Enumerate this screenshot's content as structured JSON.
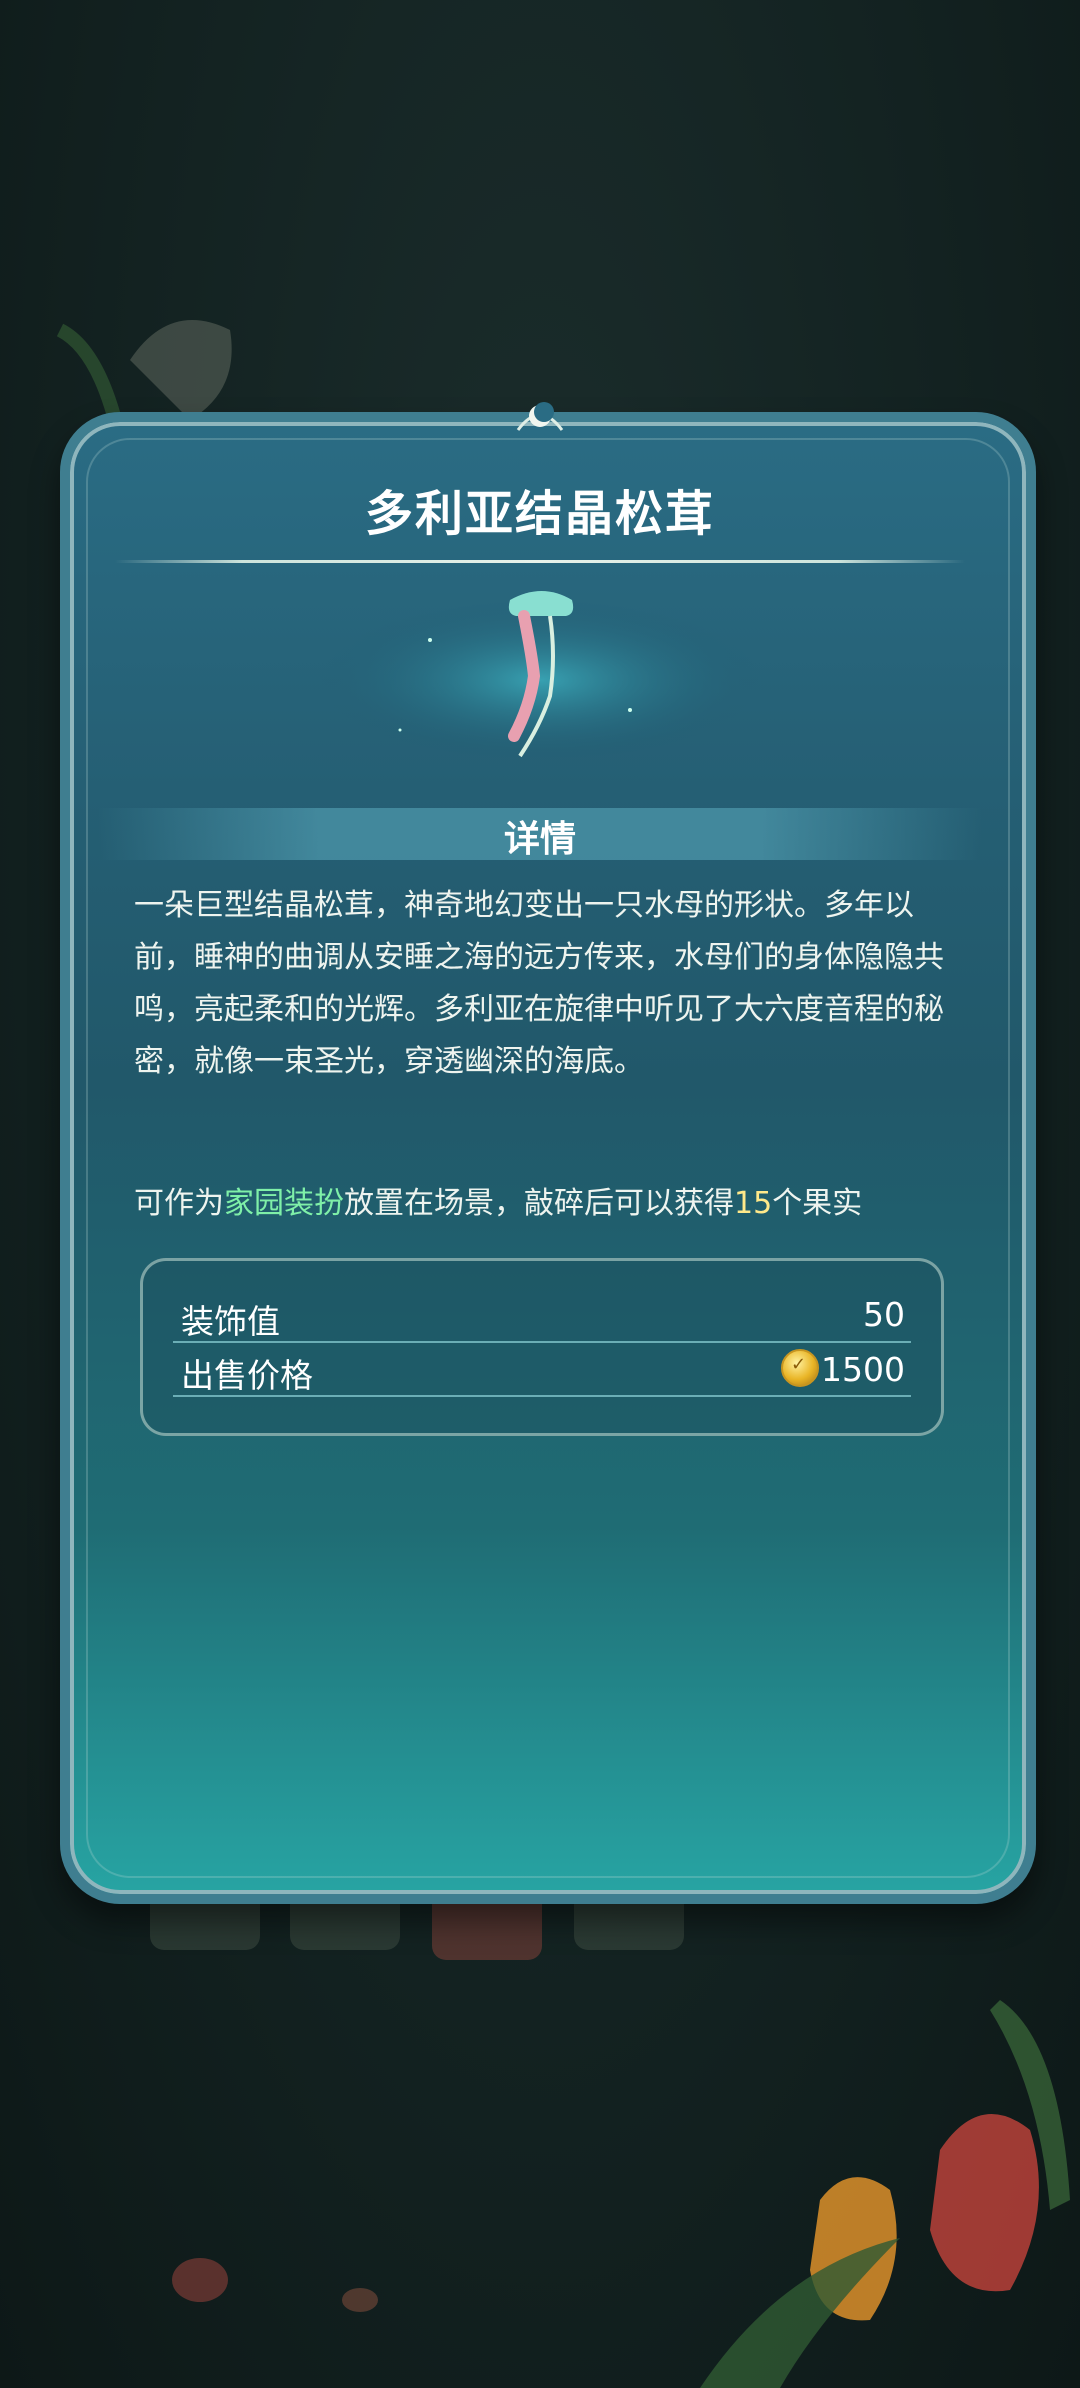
{
  "item": {
    "title": "多利亚结晶松茸",
    "section_title": "详情",
    "description": "一朵巨型结晶松茸，神奇地幻变出一只水母的形状。多年以前，睡神的曲调从安睡之海的远方传来，水母们的身体隐隐共鸣，亮起柔和的光辉。多利亚在旋律中听见了大六度音程的秘密，就像一束圣光，穿透幽深的海底。",
    "note": {
      "prefix": "可作为",
      "highlight": "家园装扮",
      "middle": "放置在场景，敲碎后可以获得",
      "count": "15",
      "suffix": "个果实"
    }
  },
  "stats": [
    {
      "label": "装饰值",
      "value": "50"
    },
    {
      "label": "出售价格",
      "value": "1500",
      "icon": "coin-icon"
    }
  ],
  "colors": {
    "highlight_green": "#7ff0a8",
    "highlight_yellow": "#ffe98a",
    "card_top": "#2a6c84",
    "card_bottom": "#27a4a3"
  }
}
